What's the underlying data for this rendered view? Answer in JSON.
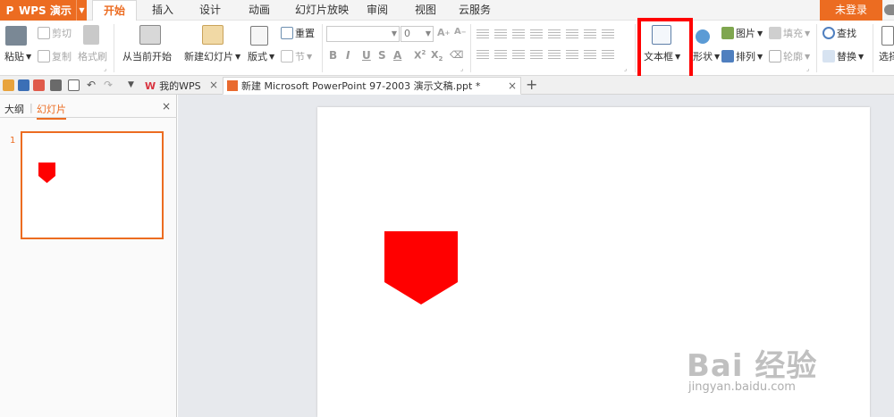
{
  "app": {
    "name": "WPS 演示",
    "login_label": "未登录"
  },
  "menu": {
    "tabs": [
      "开始",
      "插入",
      "设计",
      "动画",
      "幻灯片放映",
      "审阅",
      "视图",
      "云服务"
    ]
  },
  "ribbon": {
    "paste": "粘贴",
    "cut": "剪切",
    "copy": "复制",
    "format_painter": "格式刷",
    "from_current": "从当前开始",
    "new_slide": "新建幻灯片",
    "layout": "版式",
    "reset": "重置",
    "section": "节",
    "font_size": "0",
    "textbox": "文本框",
    "shape": "形状",
    "picture": "图片",
    "fill": "填充",
    "arrange": "排列",
    "outline": "轮廓",
    "find": "查找",
    "replace": "替换",
    "select": "选择"
  },
  "doc_tabs": {
    "home_tab": "我的WPS",
    "current_tab": "新建 Microsoft PowerPoint 97-2003 演示文稿.ppt *"
  },
  "left_panel": {
    "outline_tab": "大纲",
    "slides_tab": "幻灯片",
    "slide_number": "1"
  },
  "watermark": {
    "brand": "Bai 经验",
    "site": "jingyan.baidu.com"
  },
  "colors": {
    "accent": "#ec6c21",
    "shape": "#ff0000",
    "highlight": "#ff0000"
  }
}
